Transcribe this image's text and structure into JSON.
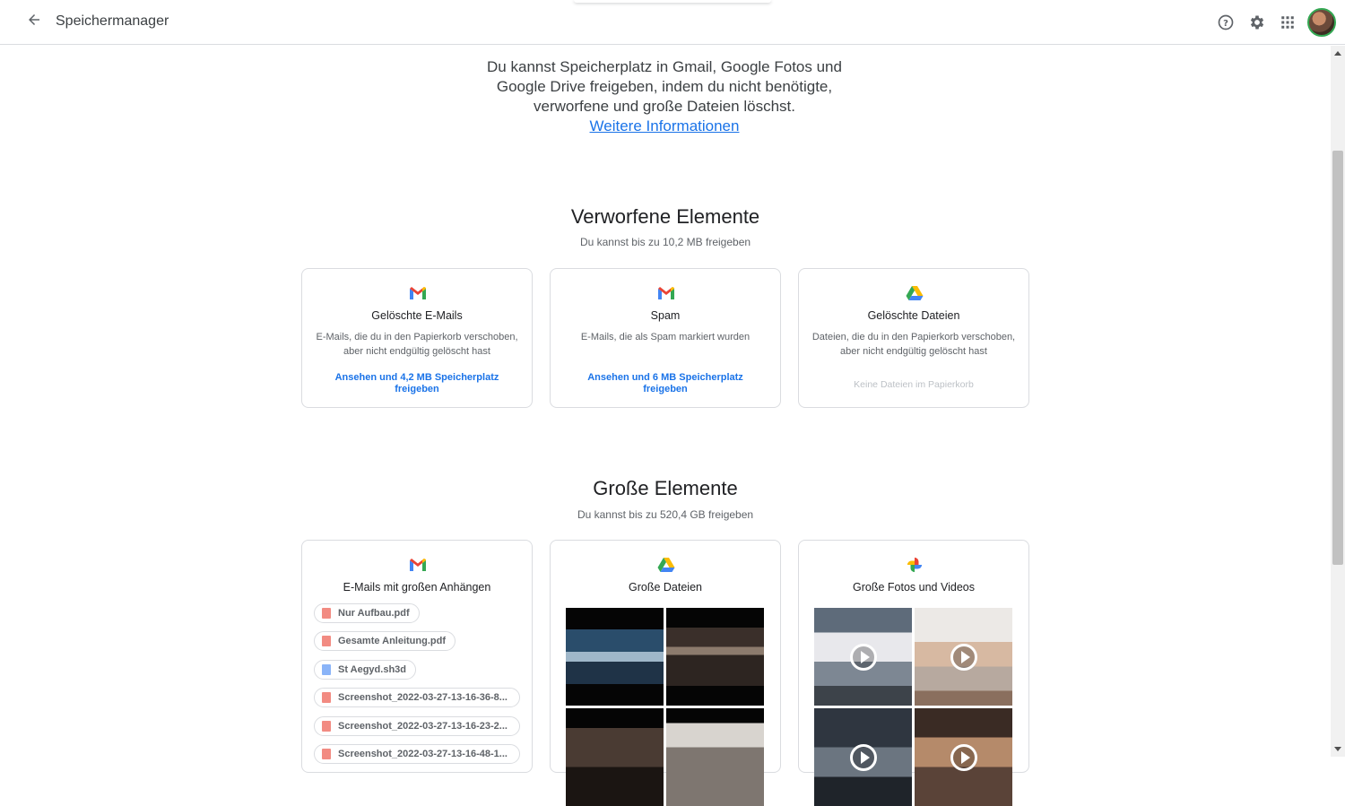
{
  "header": {
    "title": "Speichermanager",
    "icons": [
      "back-arrow-icon",
      "help-icon",
      "settings-icon",
      "apps-icon",
      "avatar"
    ]
  },
  "intro": {
    "text": "Du kannst Speicherplatz in Gmail, Google Fotos und Google Drive freigeben, indem du nicht benötigte, verworfene und große Dateien löschst.",
    "link": "Weitere Informationen"
  },
  "discarded": {
    "title": "Verworfene Elemente",
    "subtitle": "Du kannst bis zu 10,2 MB freigeben",
    "cards": [
      {
        "icon": "gmail-icon",
        "title": "Gelöschte E-Mails",
        "desc": "E-Mails, die du in den Papierkorb verschoben, aber nicht endgültig gelöscht hast",
        "action": "Ansehen und 4,2 MB Speicherplatz freigeben"
      },
      {
        "icon": "gmail-icon",
        "title": "Spam",
        "desc": "E-Mails, die als Spam markiert wurden",
        "action": "Ansehen und 6 MB Speicherplatz freigeben"
      },
      {
        "icon": "drive-icon",
        "title": "Gelöschte Dateien",
        "desc": "Dateien, die du in den Papierkorb verschoben, aber nicht endgültig gelöscht hast",
        "status": "Keine Dateien im Papierkorb"
      }
    ]
  },
  "large": {
    "title": "Große Elemente",
    "subtitle": "Du kannst bis zu 520,4 GB freigeben",
    "cards": [
      {
        "icon": "gmail-icon",
        "title": "E-Mails mit großen Anhängen",
        "files": [
          {
            "name": "Nur Aufbau.pdf",
            "type": "pdf"
          },
          {
            "name": "Gesamte Anleitung.pdf",
            "type": "pdf"
          },
          {
            "name": "St Aegyd.sh3d",
            "type": "doc"
          },
          {
            "name": "Screenshot_2022-03-27-13-16-36-8...",
            "type": "img"
          },
          {
            "name": "Screenshot_2022-03-27-13-16-23-2...",
            "type": "img"
          },
          {
            "name": "Screenshot_2022-03-27-13-16-48-1...",
            "type": "img"
          }
        ]
      },
      {
        "icon": "drive-icon",
        "title": "Große Dateien"
      },
      {
        "icon": "photos-icon",
        "title": "Große Fotos und Videos"
      }
    ]
  },
  "colors": {
    "link": "#1a73e8",
    "border": "#dadce0",
    "muted": "#5f6368"
  }
}
